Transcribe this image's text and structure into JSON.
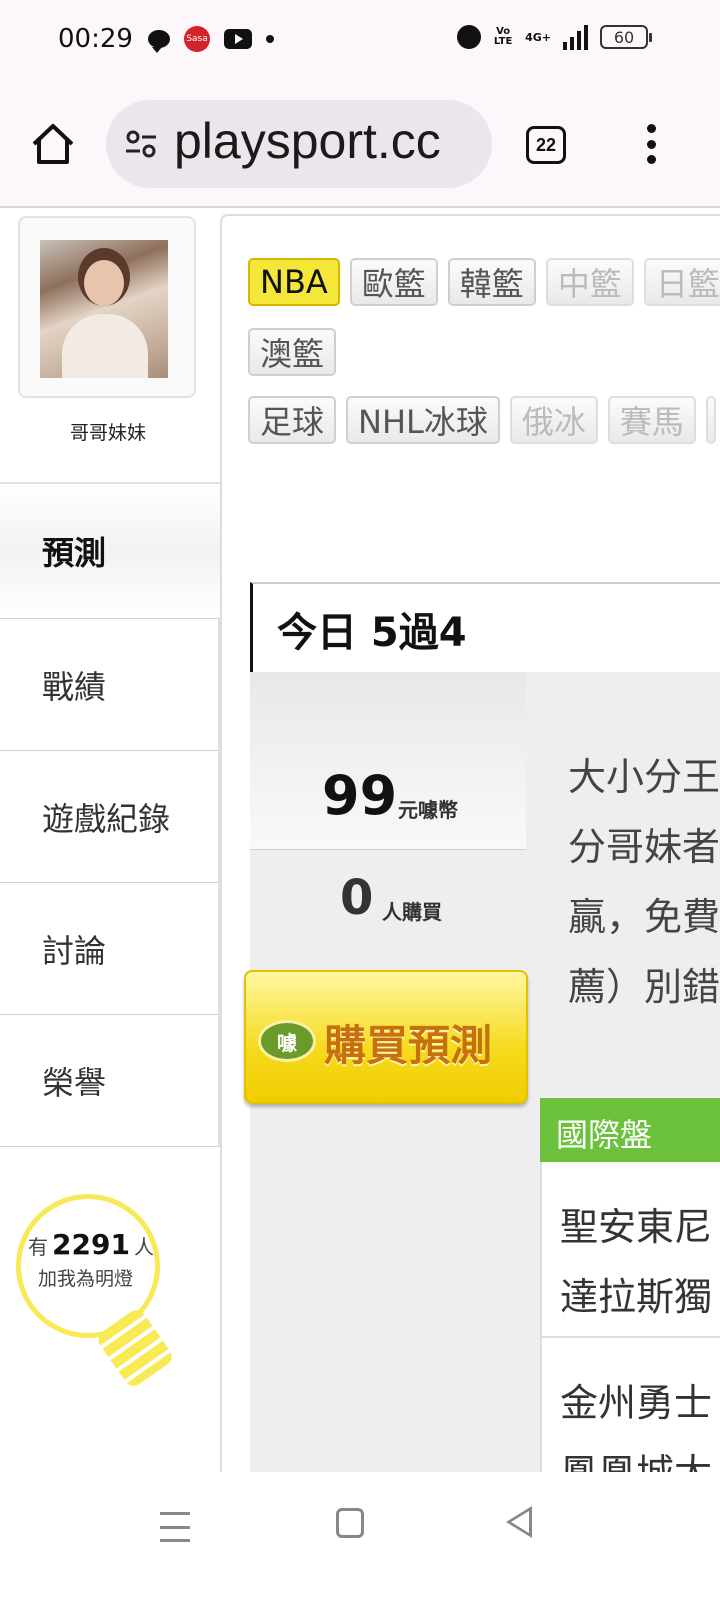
{
  "status_bar": {
    "time": "00:29",
    "red_app_label": "Sasa",
    "network": "4G+",
    "volte": "Vo LTE",
    "battery": "60"
  },
  "browser": {
    "url": "playsport.cc",
    "tab_count": "22"
  },
  "profile": {
    "name": "哥哥妹妹"
  },
  "side_nav": {
    "active": "預測",
    "items": [
      "戰績",
      "遊戲紀錄",
      "討論",
      "榮譽"
    ]
  },
  "fans": {
    "prefix": "有",
    "count": "2291",
    "suffix": "人",
    "line2": "加我為明燈"
  },
  "filters": {
    "row1": [
      "NBA",
      "歐籃",
      "韓籃",
      "中籃",
      "日籃"
    ],
    "row2": [
      "澳籃"
    ],
    "row3": [
      "足球",
      "NHL冰球",
      "俄冰",
      "賽馬"
    ],
    "active": "NBA",
    "disabled": [
      "中籃",
      "日籃",
      "俄冰",
      "賽馬"
    ]
  },
  "prediction": {
    "today_label": "今日 5過4",
    "price": "99",
    "price_unit": "元噱幣",
    "buyers": "0",
    "buyers_unit": "人購買",
    "buy_button_label": "購買預測",
    "coin_glyph": "噱",
    "description_lines": [
      "大小分王",
      "分哥妹者",
      "贏，免費",
      "薦）別錯"
    ]
  },
  "games": {
    "header": "國際盤",
    "items": [
      {
        "line1": "聖安東尼",
        "line2": "達拉斯獨"
      },
      {
        "line1": "金州勇士",
        "line2": "鳳凰城太"
      }
    ]
  }
}
